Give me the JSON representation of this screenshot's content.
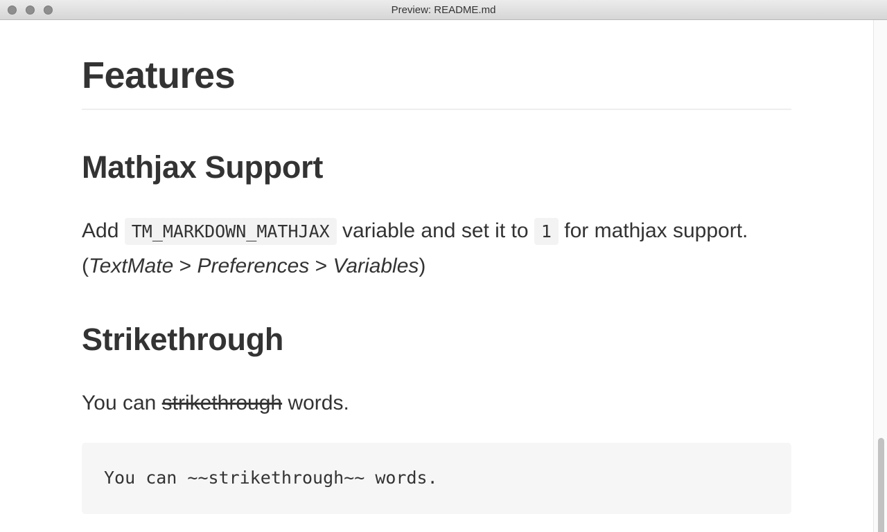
{
  "window": {
    "title": "Preview: README.md"
  },
  "doc": {
    "h1": "Features",
    "section1": {
      "heading": "Mathjax Support",
      "p_add": "Add ",
      "code_var": "TM_MARKDOWN_MATHJAX",
      "p_mid": " variable and set it to ",
      "code_val": "1",
      "p_end": " for mathjax support. (",
      "em_textmate": "TextMate",
      "sep1": " > ",
      "em_preferences": "Preferences",
      "sep2": " > ",
      "em_variables": "Variables",
      "close_paren": ")"
    },
    "section2": {
      "heading": "Strikethrough",
      "p_start": "You can ",
      "struck": "strikethrough",
      "p_end": " words.",
      "code_block": "You can ~~strikethrough~~ words."
    }
  },
  "icons": {
    "close": "close-button-icon",
    "minimize": "minimize-button-icon",
    "zoom": "zoom-button-icon"
  }
}
